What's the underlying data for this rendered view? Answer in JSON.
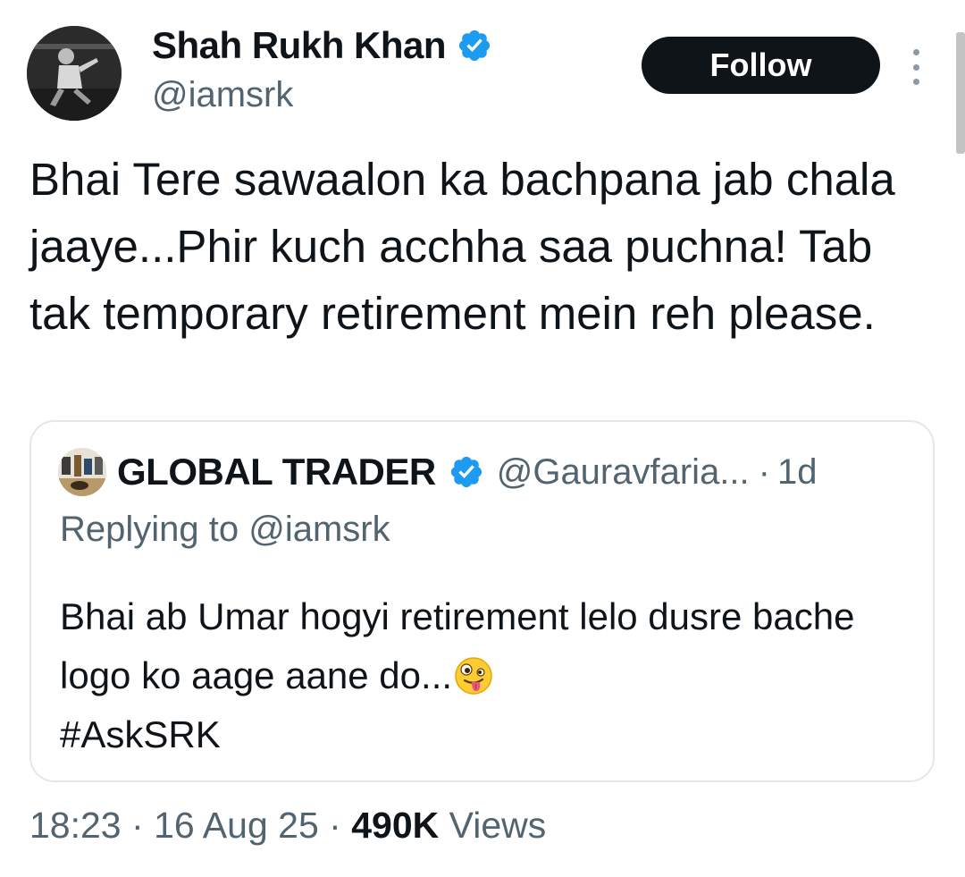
{
  "author": {
    "name": "Shah Rukh Khan",
    "handle": "@iamsrk",
    "verified": true,
    "avatar_icon": "profile-photo"
  },
  "actions": {
    "follow_label": "Follow",
    "more_icon": "more-vertical-icon"
  },
  "tweet": {
    "text": "Bhai Tere sawaalon ka bachpana jab chala jaaye...Phir kuch acchha saa puchna! Tab tak temporary retirement mein reh please."
  },
  "quoted": {
    "name": "GLOBAL TRADER",
    "handle": "@Gauravfaria...",
    "separator": "·",
    "time": "1d",
    "verified": true,
    "replying_prefix": "Replying to ",
    "replying_handle": "@iamsrk",
    "text": "Bhai ab Umar hogyi retirement lelo dusre bache logo ko aage aane do...",
    "emoji": "zany-face",
    "hashtag": "#AskSRK"
  },
  "meta": {
    "time": "18:23",
    "date": "16 Aug 25",
    "separator": "·",
    "views_count": "490K",
    "views_label": "Views"
  },
  "colors": {
    "text": "#0f1419",
    "secondary": "#536471",
    "verified": "#1d9bf0",
    "border": "#e1e8ed",
    "button_bg": "#0f1419"
  }
}
